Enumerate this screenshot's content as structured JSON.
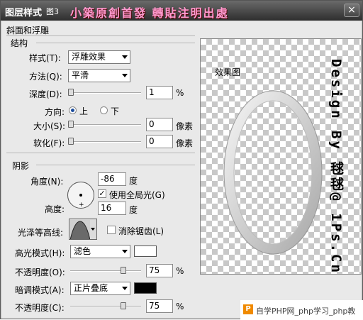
{
  "window": {
    "title": "图层样式",
    "figure_label": "图3",
    "banner": "小築原創首發 轉貼注明出處",
    "close_symbol": "×"
  },
  "bevel": {
    "section_title": "斜面和浮雕",
    "structure_title": "结构",
    "style_label": "样式(T):",
    "style_value": "浮雕效果",
    "technique_label": "方法(Q):",
    "technique_value": "平滑",
    "depth_label": "深度(D):",
    "depth_value": "1",
    "depth_unit": "%",
    "depth_level": 0.01,
    "direction_label": "方向:",
    "direction_up": "上",
    "direction_down": "下",
    "direction_selected": "上",
    "size_label": "大小(S):",
    "size_value": "0",
    "size_unit": "像素",
    "soften_label": "软化(F):",
    "soften_value": "0",
    "soften_unit": "像素"
  },
  "shading": {
    "title": "阴影",
    "angle_label": "角度(N):",
    "angle_value": "-86",
    "angle_unit": "度",
    "global_light_label": "使用全局光(G)",
    "global_light_checked": true,
    "altitude_label": "高度:",
    "altitude_value": "16",
    "altitude_unit": "度",
    "gloss_contour_label": "光泽等高线:",
    "antialias_label": "消除锯齿(L)",
    "antialias_checked": false,
    "highlight_mode_label": "高光模式(H):",
    "highlight_mode_value": "滤色",
    "highlight_color": "#ffffff",
    "highlight_opacity_label": "不透明度(O):",
    "highlight_opacity_value": "75",
    "highlight_opacity_unit": "%",
    "highlight_opacity_level": 0.75,
    "shadow_mode_label": "暗调模式(A):",
    "shadow_mode_value": "正片叠底",
    "shadow_color": "#000000",
    "shadow_opacity_label": "不透明度(C):",
    "shadow_opacity_value": "75",
    "shadow_opacity_unit": "%",
    "shadow_opacity_level": 0.75
  },
  "preview": {
    "caption": "效果图",
    "vertical_text": "Design By 毬毬@ 1Ps.Cn"
  },
  "watermark": {
    "text": "自学PHP网_php学习_php教"
  }
}
